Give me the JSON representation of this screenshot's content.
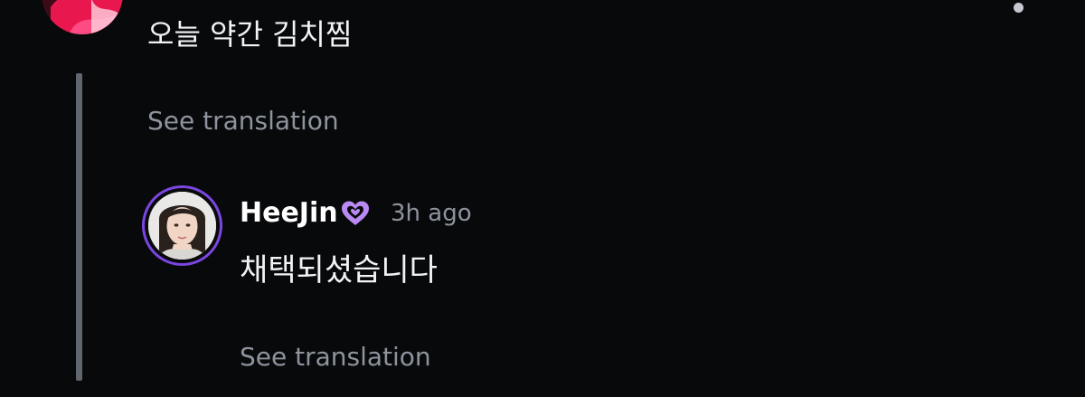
{
  "parent_comment": {
    "text": "오늘 약간 김치찜",
    "see_translation_label": "See translation",
    "more_icon": "more-vertical-icon"
  },
  "reply": {
    "author_name": "HeeJin",
    "badge_icon": "artist-heart-badge-icon",
    "time_ago": "3h ago",
    "text": "채택되셨습니다",
    "see_translation_label": "See translation"
  },
  "colors": {
    "background": "#08090b",
    "primary_text": "#f2f3f5",
    "secondary_text": "#8d949d",
    "thread_line": "#5f666e",
    "avatar_ring": "#7b46e0",
    "badge": "#b98af4"
  }
}
